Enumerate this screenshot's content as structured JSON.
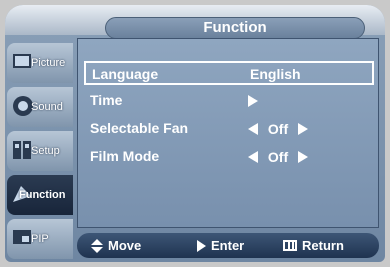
{
  "menu": {
    "title": "Function"
  },
  "sidebar": {
    "items": [
      {
        "label": "Picture",
        "icon": "picture-icon",
        "active": false
      },
      {
        "label": "Sound",
        "icon": "speaker-icon",
        "active": false
      },
      {
        "label": "Setup",
        "icon": "setup-icon",
        "active": false
      },
      {
        "label": "Function",
        "icon": "function-icon",
        "active": true
      },
      {
        "label": "PIP",
        "icon": "pip-icon",
        "active": false
      }
    ]
  },
  "rows": [
    {
      "label": "Language",
      "value": "English",
      "type": "text",
      "selected": true
    },
    {
      "label": "Time",
      "value": "",
      "type": "submenu",
      "selected": false
    },
    {
      "label": "Selectable Fan",
      "value": "Off",
      "type": "spinner",
      "selected": false
    },
    {
      "label": "Film Mode",
      "value": "Off",
      "type": "spinner",
      "selected": false
    }
  ],
  "footer": {
    "move": "Move",
    "enter": "Enter",
    "return": "Return"
  },
  "colors": {
    "selection_border": "#ffffff",
    "panel": "#7890ad",
    "active_tab": "#1f2d45"
  }
}
